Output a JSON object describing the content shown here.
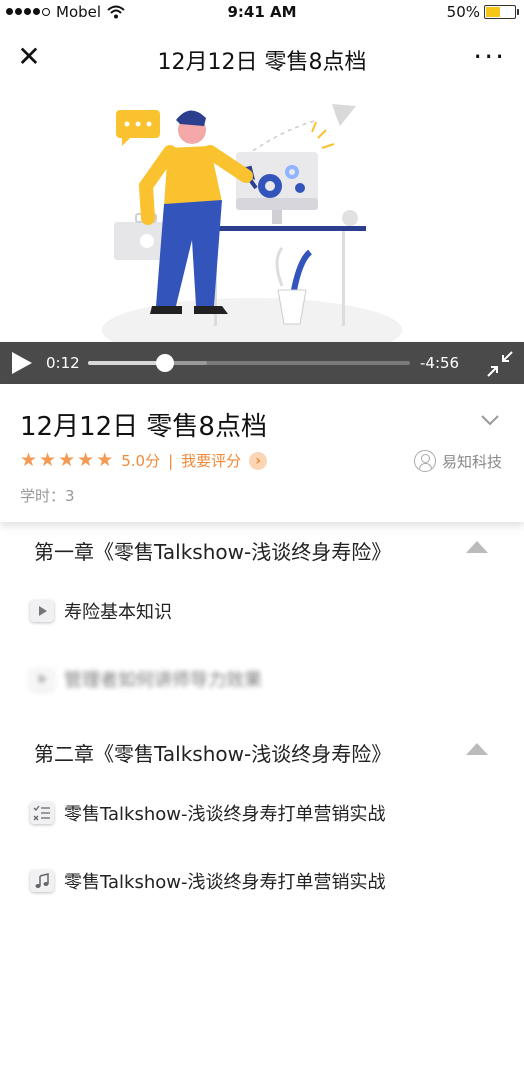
{
  "status": {
    "carrier": "Mobel",
    "time": "9:41 AM",
    "battery_pct": "50%",
    "battery_level": 0.5
  },
  "nav": {
    "close_glyph": "✕",
    "title": "12月12日 零售8点档",
    "more_glyph": "···"
  },
  "video": {
    "current": "0:12",
    "remaining": "-4:56",
    "progress": 0.24,
    "buffered": 0.37
  },
  "course": {
    "title": "12月12日 零售8点档",
    "stars": 5,
    "score": "5.0分",
    "separator": "|",
    "rate_label": "我要评分",
    "org": "易知科技",
    "hours_label": "学时：",
    "hours": "3"
  },
  "chapters": [
    {
      "title": "第一章《零售Talkshow-浅谈终身寿险》",
      "lessons": [
        {
          "label": "寿险基本知识",
          "icon": "video-play-icon"
        },
        {
          "label": "管理者如何讲师导力效果",
          "icon": "video-play-icon"
        }
      ]
    },
    {
      "title": "第二章《零售Talkshow-浅谈终身寿险》",
      "lessons": [
        {
          "label": "零售Talkshow-浅谈终身寿打单营销实战",
          "icon": "checklist-icon"
        },
        {
          "label": "零售Talkshow-浅谈终身寿打单营销实战",
          "icon": "audio-note-icon"
        }
      ]
    }
  ],
  "colors": {
    "accent": "#f08a3a",
    "video_bar": "#4a4a4a",
    "illustration_yellow": "#f9c22e",
    "illustration_blue": "#3355bb"
  }
}
